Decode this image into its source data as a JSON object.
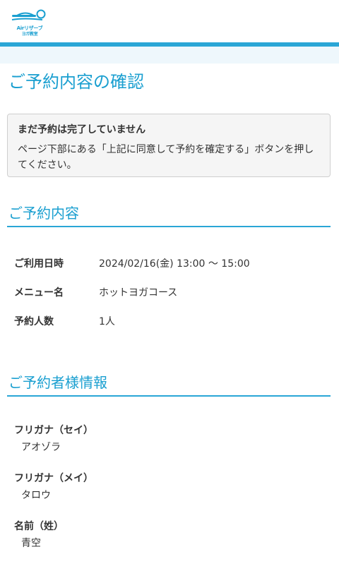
{
  "header": {
    "logo_line1": "Airリザーブ",
    "logo_line2": "ヨガ教室",
    "colors": {
      "accent": "#1a9fd0",
      "bar": "#2aa6d6",
      "band": "#eef7fc"
    }
  },
  "page": {
    "title": "ご予約内容の確認"
  },
  "notice": {
    "title": "まだ予約は完了していません",
    "body": "ページ下部にある「上記に同意して予約を確定する」ボタンを押してください。"
  },
  "reservation": {
    "heading": "ご予約内容",
    "rows": [
      {
        "label": "ご利用日時",
        "value": "2024/02/16(金) 13:00 〜 15:00"
      },
      {
        "label": "メニュー名",
        "value": "ホットヨガコース"
      },
      {
        "label": "予約人数",
        "value": "1人"
      }
    ]
  },
  "customer": {
    "heading": "ご予約者様情報",
    "fields": [
      {
        "label": "フリガナ（セイ）",
        "value": "アオゾラ"
      },
      {
        "label": "フリガナ（メイ）",
        "value": "タロウ"
      },
      {
        "label": "名前（姓）",
        "value": "青空"
      }
    ]
  }
}
